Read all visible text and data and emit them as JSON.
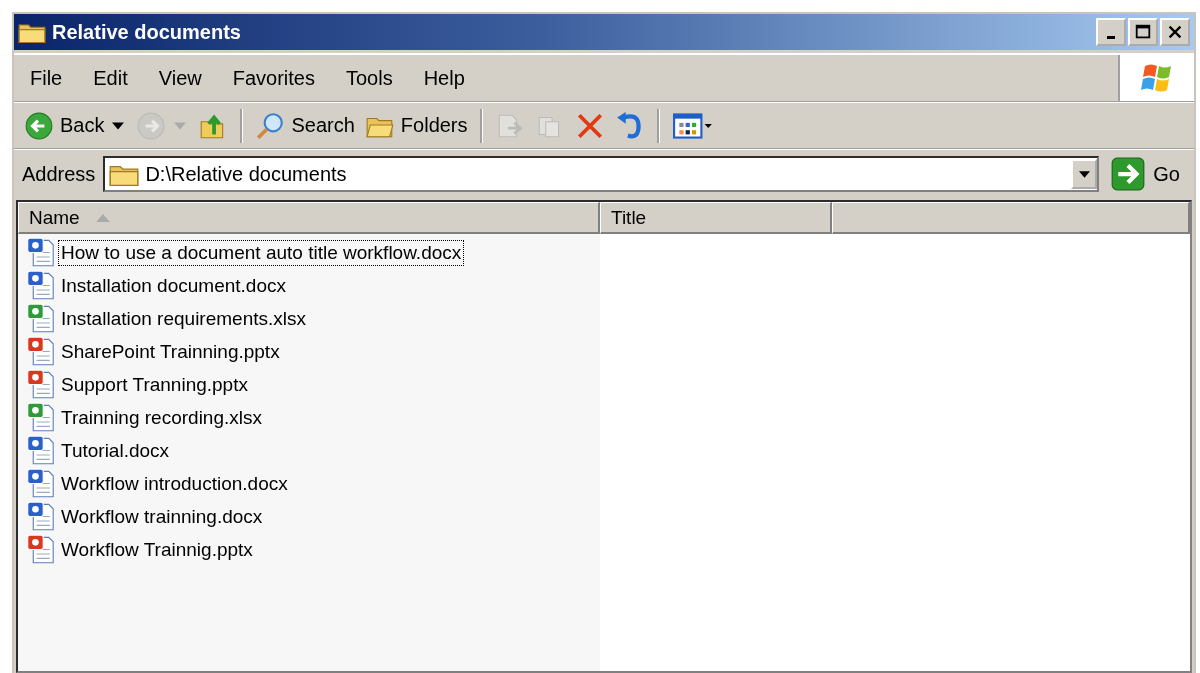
{
  "window": {
    "title": "Relative documents"
  },
  "menu": [
    "File",
    "Edit",
    "View",
    "Favorites",
    "Tools",
    "Help"
  ],
  "toolbar": [
    {
      "kind": "back",
      "label": "Back",
      "disabled": false
    },
    {
      "kind": "forward",
      "disabled": true
    },
    {
      "kind": "up",
      "disabled": false
    },
    {
      "kind": "separator"
    },
    {
      "kind": "search",
      "label": "Search",
      "disabled": false
    },
    {
      "kind": "folders",
      "label": "Folders",
      "disabled": false
    },
    {
      "kind": "separator"
    },
    {
      "kind": "move",
      "disabled": true
    },
    {
      "kind": "copy",
      "disabled": true
    },
    {
      "kind": "delete",
      "disabled": false
    },
    {
      "kind": "undo",
      "disabled": false
    },
    {
      "kind": "separator"
    },
    {
      "kind": "views",
      "disabled": false
    }
  ],
  "address": {
    "label": "Address",
    "value": "D:\\Relative documents",
    "go": "Go"
  },
  "columns": [
    {
      "label": "Name",
      "sorted": true
    },
    {
      "label": "Title",
      "sorted": false
    }
  ],
  "files": [
    {
      "name": "How to use a document auto title workflow.docx",
      "kind": "word",
      "focused": true
    },
    {
      "name": "Installation document.docx",
      "kind": "word",
      "focused": false
    },
    {
      "name": "Installation requirements.xlsx",
      "kind": "excel",
      "focused": false
    },
    {
      "name": "SharePoint Trainning.pptx",
      "kind": "powerpoint",
      "focused": false
    },
    {
      "name": "Support Tranning.pptx",
      "kind": "powerpoint",
      "focused": false
    },
    {
      "name": "Trainning recording.xlsx",
      "kind": "excel",
      "focused": false
    },
    {
      "name": "Tutorial.docx",
      "kind": "word",
      "focused": false
    },
    {
      "name": "Workflow introduction.docx",
      "kind": "word",
      "focused": false
    },
    {
      "name": "Workflow trainning.docx",
      "kind": "word",
      "focused": false
    },
    {
      "name": "Workflow Trainnig.pptx",
      "kind": "powerpoint",
      "focused": false
    }
  ]
}
